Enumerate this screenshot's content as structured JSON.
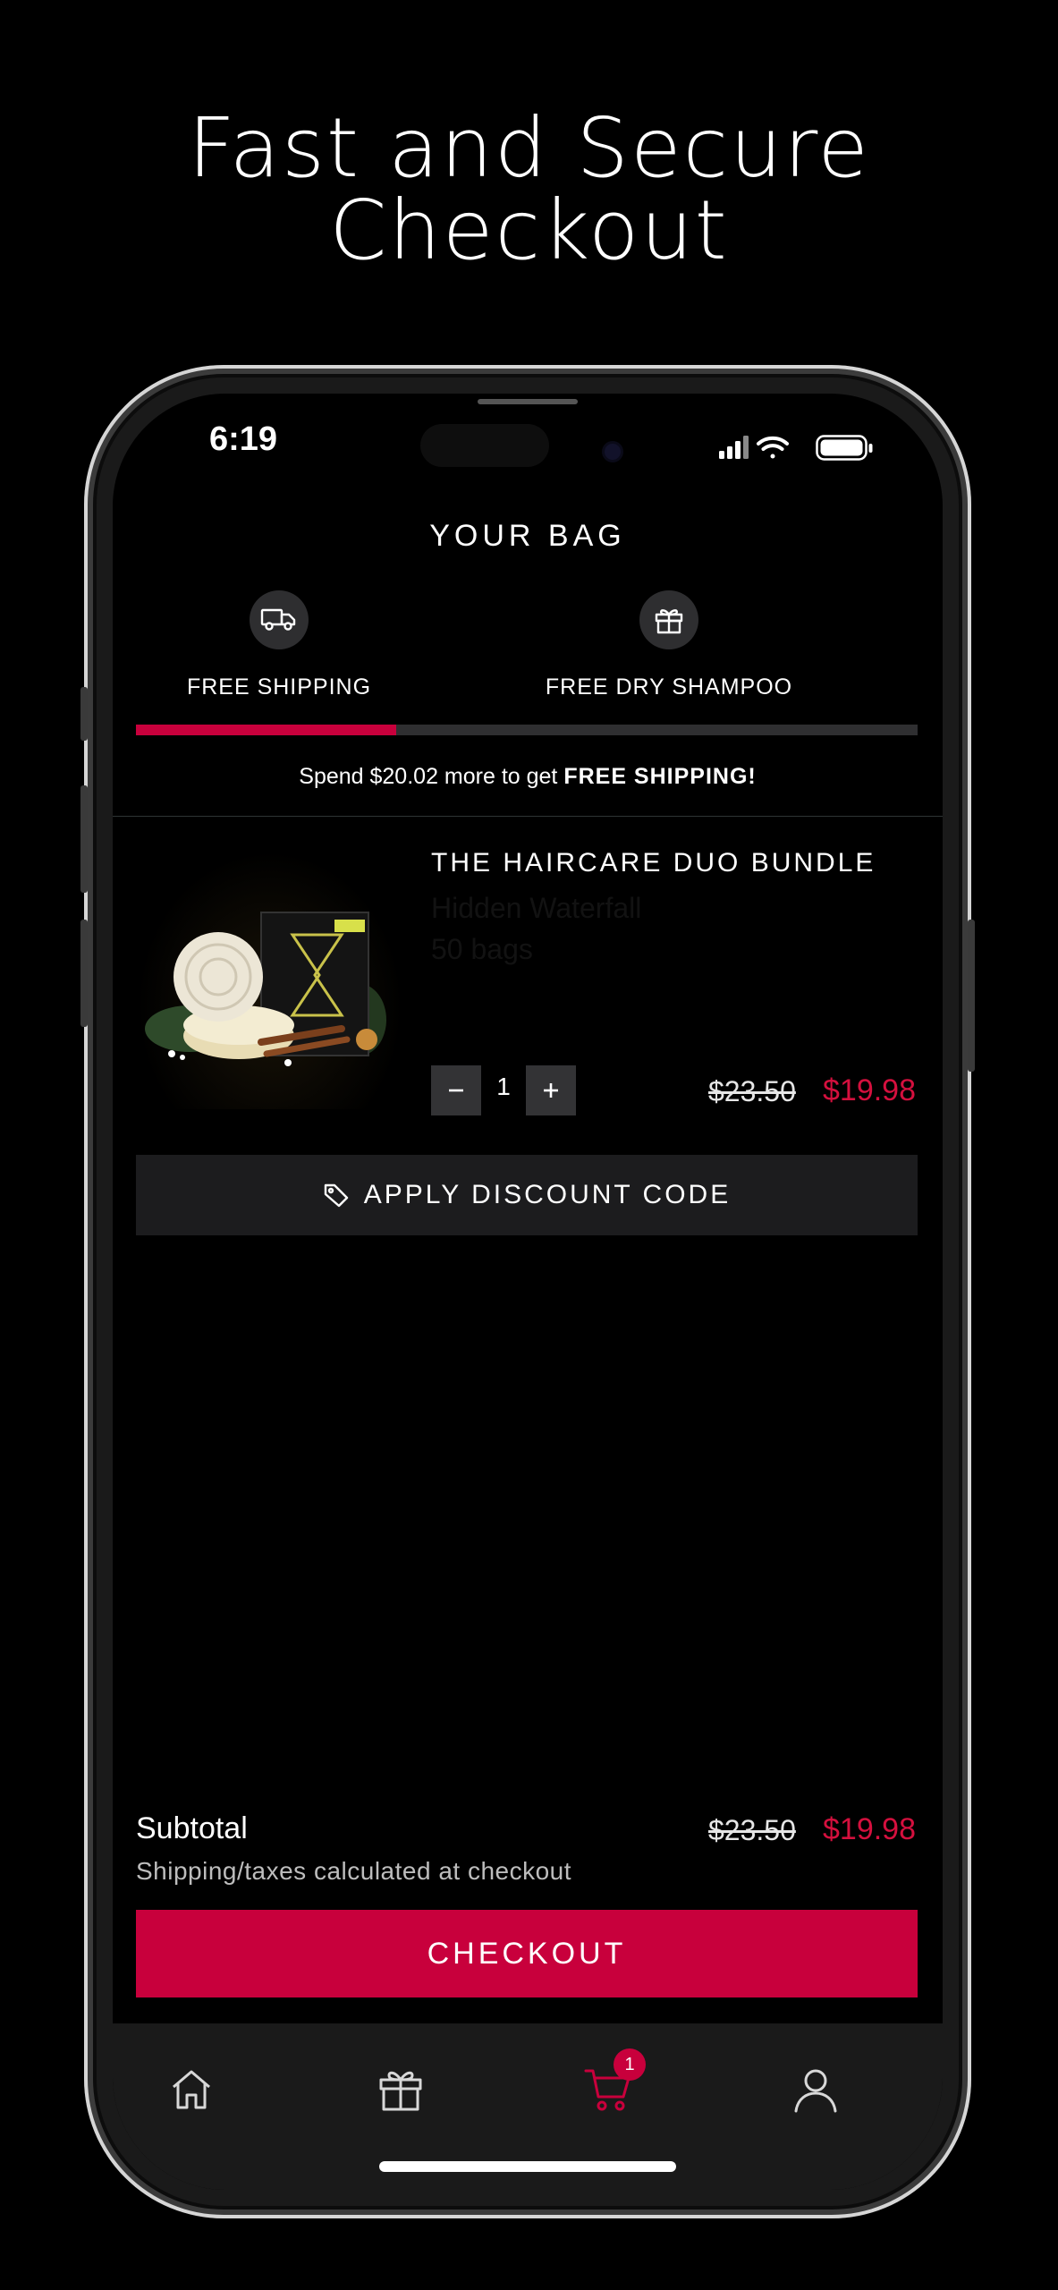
{
  "headline": {
    "line1": "Fast and Secure",
    "line2": "Checkout"
  },
  "status_bar": {
    "time": "6:19",
    "icons": [
      "signal-icon",
      "wifi-icon",
      "battery-icon"
    ]
  },
  "bag": {
    "title": "YOUR BAG",
    "perks": [
      {
        "label": "FREE SHIPPING",
        "icon": "truck-icon"
      },
      {
        "label": "FREE DRY SHAMPOO",
        "icon": "gift-icon"
      }
    ],
    "progress": 0.333,
    "promo": {
      "text": "Spend $20.02 more to get ",
      "bold": "FREE SHIPPING!"
    }
  },
  "item": {
    "name": "THE HAIRCARE DUO BUNDLE",
    "variant_line1": "Hidden Waterfall",
    "variant_line2": "50 bags",
    "quantity": "1",
    "old_price": "$23.50",
    "new_price": "$19.98"
  },
  "discount": {
    "label": "APPLY DISCOUNT CODE"
  },
  "summary": {
    "subtotal_label": "Subtotal",
    "old_price": "$23.50",
    "new_price": "$19.98",
    "shipping_note": "Shipping/taxes calculated at checkout"
  },
  "checkout": {
    "label": "CHECKOUT"
  },
  "tabbar": {
    "items": [
      {
        "name": "home",
        "icon": "home-icon"
      },
      {
        "name": "rewards",
        "icon": "gift-icon"
      },
      {
        "name": "cart",
        "icon": "cart-icon",
        "badge": "1",
        "active": true
      },
      {
        "name": "account",
        "icon": "user-icon"
      }
    ]
  },
  "colors": {
    "accent": "#c8003c",
    "price": "#d4103e",
    "background": "#000000",
    "panel": "#1c1c1e"
  }
}
